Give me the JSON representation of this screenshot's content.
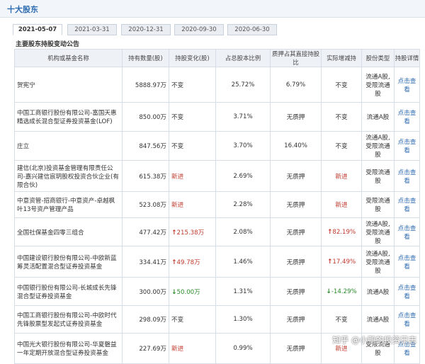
{
  "section": {
    "title": "十大股东"
  },
  "tabs": [
    {
      "label": "2021-05-07",
      "active": true
    },
    {
      "label": "2021-03-31",
      "active": false
    },
    {
      "label": "2020-12-31",
      "active": false
    },
    {
      "label": "2020-09-30",
      "active": false
    },
    {
      "label": "2020-06-30",
      "active": false
    }
  ],
  "subtitle": "主要股东持股变动公告",
  "table": {
    "headers": [
      "机构或基金名称",
      "持有数量(股)",
      "持股变化(股)",
      "占总股本比例",
      "质押占其直接持股比",
      "实际增减持",
      "股份类型",
      "持股详情"
    ],
    "rows": [
      {
        "name": "贺宪宁",
        "shares": "5888.97万",
        "change": "不变",
        "change_dir": "none",
        "ratio": "25.72%",
        "pledge": "6.79%",
        "actual": "不变",
        "actual_dir": "none",
        "type": "流通A股,受限流通股",
        "detail": "点击查看"
      },
      {
        "name": "中国工商银行股份有限公司-富国天惠精选成长混合型证券投资基金(LOF)",
        "shares": "850.00万",
        "change": "不变",
        "change_dir": "none",
        "ratio": "3.71%",
        "pledge": "无质押",
        "actual": "不变",
        "actual_dir": "none",
        "type": "流通A股",
        "detail": "点击查看"
      },
      {
        "name": "庄立",
        "shares": "847.56万",
        "change": "不变",
        "change_dir": "none",
        "ratio": "3.70%",
        "pledge": "16.40%",
        "actual": "不变",
        "actual_dir": "none",
        "type": "流通A股,受限流通股",
        "detail": "点击查看"
      },
      {
        "name": "建信(北京)投资基金管理有限责任公司-嘉兴建信宸玥股权投资合伙企业(有限合伙)",
        "shares": "615.38万",
        "change": "新进",
        "change_dir": "new",
        "ratio": "2.69%",
        "pledge": "无质押",
        "actual": "新进",
        "actual_dir": "new",
        "type": "受限流通股",
        "detail": "点击查看"
      },
      {
        "name": "中意资管-招商银行-中意资产-卓越枫叶13号资产管理产品",
        "shares": "523.08万",
        "change": "新进",
        "change_dir": "new",
        "ratio": "2.28%",
        "pledge": "无质押",
        "actual": "新进",
        "actual_dir": "new",
        "type": "受限流通股",
        "detail": "点击查看"
      },
      {
        "name": "全国社保基金四零三组合",
        "shares": "477.42万",
        "change": "215.38万",
        "change_dir": "up",
        "ratio": "2.08%",
        "pledge": "无质押",
        "actual": "82.19%",
        "actual_dir": "up",
        "type": "流通A股,受限流通股",
        "detail": "点击查看"
      },
      {
        "name": "中国建设银行股份有限公司-中欧新蓝筹灵活配置混合型证券投资基金",
        "shares": "334.41万",
        "change": "49.78万",
        "change_dir": "up",
        "ratio": "1.46%",
        "pledge": "无质押",
        "actual": "17.49%",
        "actual_dir": "up",
        "type": "流通A股,受限流通股",
        "detail": "点击查看"
      },
      {
        "name": "中国银行股份有限公司-长城成长先锋混合型证券投资基金",
        "shares": "300.00万",
        "change": "50.00万",
        "change_dir": "down",
        "ratio": "1.31%",
        "pledge": "无质押",
        "actual": "-14.29%",
        "actual_dir": "down",
        "type": "流通A股",
        "detail": "点击查看"
      },
      {
        "name": "中国工商银行股份有限公司-中欧时代先锋股票型发起式证券投资基金",
        "shares": "298.09万",
        "change": "不变",
        "change_dir": "none",
        "ratio": "1.30%",
        "pledge": "无质押",
        "actual": "不变",
        "actual_dir": "none",
        "type": "流通A股",
        "detail": "点击查看"
      },
      {
        "name": "中国光大银行股份有限公司-华夏磐益一年定期开放混合型证券投资基金",
        "shares": "227.69万",
        "change": "新进",
        "change_dir": "new",
        "ratio": "0.99%",
        "pledge": "无质押",
        "actual": "新进",
        "actual_dir": "new",
        "type": "受限流通股",
        "detail": "点击查看"
      }
    ]
  },
  "watermark": "知乎 @小鸭的投资日志",
  "colors": {
    "accent": "#2d6bb0",
    "up": "#c0392b",
    "down": "#2b8a2b",
    "header_bg": "#eef2f7"
  },
  "icons": {
    "up": "arrow-up-icon",
    "down": "arrow-down-icon"
  }
}
